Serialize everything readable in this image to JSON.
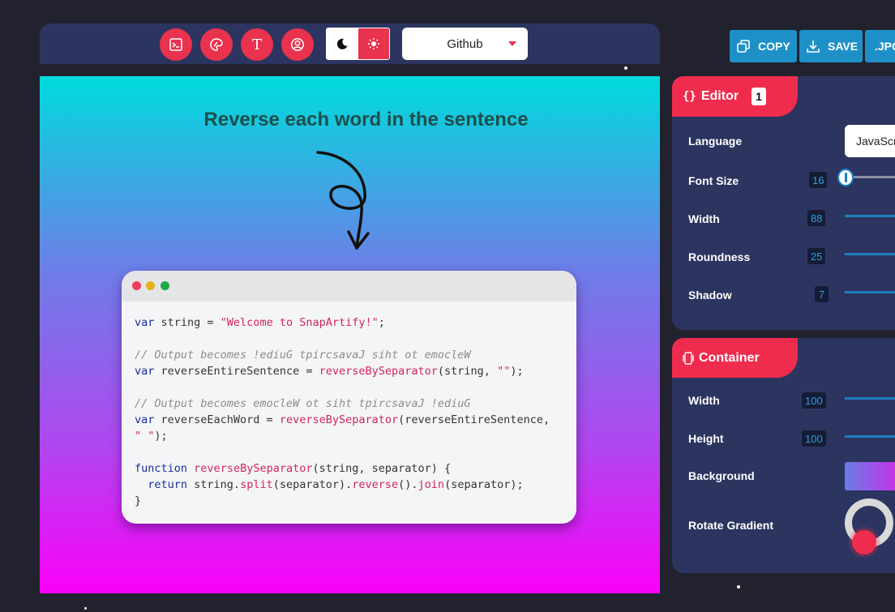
{
  "toolbar": {
    "tools": [
      {
        "icon": "terminal-icon"
      },
      {
        "icon": "palette-icon"
      },
      {
        "icon": "text-icon",
        "glyph": "T"
      },
      {
        "icon": "user-icon"
      }
    ],
    "theme": {
      "dark_icon": "moon-icon",
      "light_icon": "sun-icon",
      "active": "light"
    },
    "select": {
      "value": "Github",
      "icon": "caret-down-icon"
    }
  },
  "export": [
    {
      "label": "COPY",
      "icon": "copy-icon"
    },
    {
      "label": "SAVE",
      "icon": "download-icon"
    },
    {
      "label": ".JPG"
    }
  ],
  "canvas": {
    "title": "Reverse each word in the sentence",
    "background": [
      "#00dbdd",
      "#6e7de8",
      "#b146ef",
      "#fa00f8"
    ],
    "window_dots": [
      "#ef3d5a",
      "#e6b21a",
      "#1ea84a"
    ],
    "code": {
      "line1_kw": "var",
      "line1_rest": " string = ",
      "line1_str": "\"Welcome to SnapArtify!\"",
      "line1_end": ";",
      "line3_comment": "// Output becomes !ediuG tpircsavaJ siht ot emocleW",
      "line4_kw": "var",
      "line4_rest": " reverseEntireSentence = ",
      "line4_fn": "reverseBySeparator",
      "line4_args": "(string, ",
      "line4_str": "\"\"",
      "line4_end": ");",
      "line6_comment": "// Output becomes emocleW ot siht tpircsavaJ !ediuG",
      "line7_kw": "var",
      "line7_rest": " reverseEachWord = ",
      "line7_fn": "reverseBySeparator",
      "line7_args": "(reverseEntireSentence,",
      "line8_str": "\" \"",
      "line8_end": ");",
      "line10_kw": "function",
      "line10_sp": " ",
      "line10_fn": "reverseBySeparator",
      "line10_args": "(string, separator) {",
      "line11_kw": "  return",
      "line11_a": " string.",
      "line11_fn1": "split",
      "line11_b": "(separator).",
      "line11_fn2": "reverse",
      "line11_c": "().",
      "line11_fn3": "join",
      "line11_d": "(separator);",
      "line12": "}"
    }
  },
  "editor_panel": {
    "title": "Editor",
    "icon": "braces-icon",
    "badge": "1",
    "language": {
      "label": "Language",
      "value": "JavaScript"
    },
    "font_size": {
      "label": "Font Size",
      "value": "16"
    },
    "width": {
      "label": "Width",
      "value": "88"
    },
    "roundness": {
      "label": "Roundness",
      "value": "25"
    },
    "shadow": {
      "label": "Shadow",
      "value": "7"
    }
  },
  "container_panel": {
    "title": "Container",
    "icon": "device-icon",
    "width": {
      "label": "Width",
      "value": "100"
    },
    "height": {
      "label": "Height",
      "value": "100"
    },
    "background": {
      "label": "Background"
    },
    "rotate": {
      "label": "Rotate Gradient"
    }
  },
  "colors": {
    "accent": "#e8324e",
    "panel": "#2b3560",
    "export": "#1e90c8",
    "slider": "#1d7fbf"
  }
}
